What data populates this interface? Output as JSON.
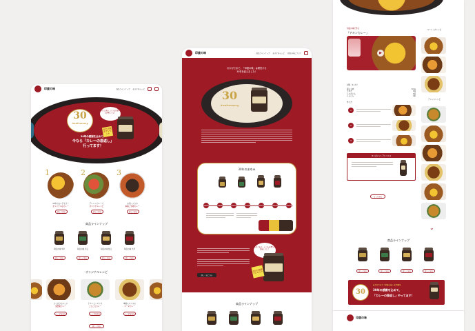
{
  "brand": {
    "logo_text": "印度の味",
    "accent": "#9e1b26",
    "gold": "#c9a548"
  },
  "nav": {
    "items": [
      "商品ラインナップ",
      "おすすめレシピ",
      "印度の味について"
    ]
  },
  "left": {
    "bubble": "みなさまの、いつもを食べた美味しさに！",
    "badge_number": "30",
    "badge_word": "Anniversary",
    "headline_1": "30年の感謝を込めて、",
    "headline_2": "今なら「カレーの恩返し」",
    "headline_3": "行ってます！",
    "note": "今だけ限定プレゼント",
    "steps": [
      {
        "num": "1",
        "label": "30年のロングセラー",
        "sub": "オリジナルなカレー"
      },
      {
        "num": "2",
        "label": "アレンジカレーで",
        "sub": "オリジナルレシピ"
      },
      {
        "num": "3",
        "label": "お気に入りの",
        "sub": "本格ご当地カレー"
      }
    ],
    "more_btn": "詳しく見る",
    "lineup_title": "商品ラインナップ",
    "recipe_title": "オリジナルレシピ",
    "recipes": [
      {
        "title": "さっぱりおいしい",
        "sub": "夏野菜カレー"
      },
      {
        "title": "チキンとトマトの",
        "sub": "ごろごろカレー"
      },
      {
        "title": "本格スパイスの",
        "sub": "キーマカレー"
      }
    ],
    "recipe_btn": "レシピを見る"
  },
  "center": {
    "intro_1": "おかげさまで、「印度の味」は発売から",
    "intro_2": "30年を迎えました！",
    "badge_number": "30",
    "badge_word": "Anniversary",
    "timeline_title": "30年のあゆみ",
    "timeline_years": [
      "1993",
      "1998",
      "2003",
      "2008",
      "2013",
      "2018",
      "2023"
    ],
    "bubble": "みなさまの、いつもを食べた美味しさに！",
    "cta": "詳しくはこちら",
    "lineup_title": "商品ラインナップ"
  },
  "right": {
    "menu_title": "ベーシックレシピ",
    "arrange_title": "アレンジレシピ",
    "recipe_name": "「チキンカレー」",
    "recipe_label": "印度の味で作る",
    "ingredients_title": "材料（4人分）",
    "ingredients": [
      {
        "name": "鶏もも肉",
        "amount": "300g"
      },
      {
        "name": "玉ねぎ",
        "amount": "1個"
      },
      {
        "name": "じゃがいも",
        "amount": "2個"
      },
      {
        "name": "にんじん",
        "amount": "1本"
      }
    ],
    "steps_title": "作り方",
    "tip_title": "ワンポイントアドバイス",
    "more_btn": "もっと見る",
    "lineup_title": "商品ラインナップ",
    "banner_1": "30年の感謝を込めて、",
    "banner_2": "「カレーの恩返し」やってます！",
    "banner_pre": "おかげさまで「印度の味」は30周年",
    "badge_number": "30",
    "footer": "印度の味"
  },
  "products": [
    {
      "name": "印度の味 中辛",
      "color": "#c8a24a"
    },
    {
      "name": "印度の味 辛口",
      "color": "#3c7a4a"
    },
    {
      "name": "印度の味 甘口",
      "color": "#d8b25c"
    },
    {
      "name": "印度の味 大辛",
      "color": "#9e1b26"
    }
  ]
}
